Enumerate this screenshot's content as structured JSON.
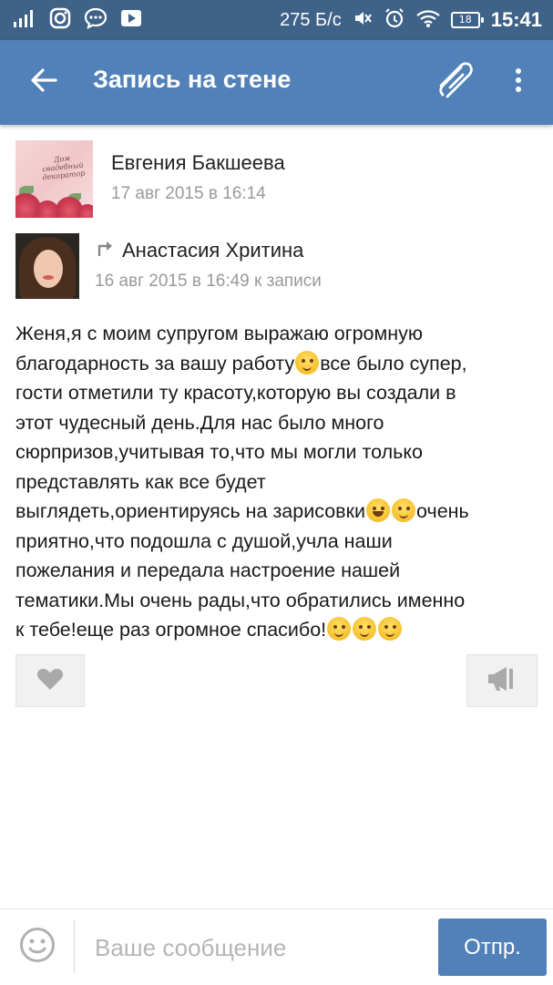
{
  "status_bar": {
    "speed": "275 Б/с",
    "battery_level": "18",
    "time": "15:41",
    "icons": [
      "signal-icon",
      "instagram-icon",
      "chat-icon",
      "youtube-icon",
      "mute-icon",
      "alarm-icon",
      "wifi-icon",
      "battery-icon"
    ]
  },
  "toolbar": {
    "title": "Запись на стене",
    "icons": [
      "back-arrow-icon",
      "paperclip-icon",
      "more-vertical-icon"
    ]
  },
  "author": {
    "name": "Евгения Бакшеева",
    "date": "17 авг 2015 в 16:14",
    "avatar_text": "Дом свадебный декоратор"
  },
  "reply": {
    "name": "Анастасия Хритина",
    "date": "16 авг 2015 в 16:49 к записи",
    "icon": "reply-arrow-icon"
  },
  "post": {
    "lines": [
      "Женя,я с моим супругом выражаю огромную",
      "благодарность за вашу работу",
      "все было супер,",
      "гости отметили ту красоту,которую вы создали в",
      "этот чудесный день.Для нас было много",
      "сюрпризов,учитывая то,что мы могли только",
      "представлять как все будет",
      "выглядеть,ориентируясь на зарисовки",
      "очень",
      "приятно,что подошла с душой,учла наши",
      "пожелания и передала настроение нашей",
      "тематики.Мы очень рады,что обратились именно",
      "к тебе!еще раз огромное спасибо!"
    ]
  },
  "actions": {
    "like_icon": "heart-icon",
    "share_icon": "megaphone-icon"
  },
  "composer": {
    "placeholder": "Ваше сообщение",
    "send_label": "Отпр.",
    "emoji_icon": "smiley-icon"
  },
  "colors": {
    "status_bar": "#3f6289",
    "toolbar": "#5181b8",
    "send_button": "#5181b8",
    "meta_text": "#999999"
  }
}
